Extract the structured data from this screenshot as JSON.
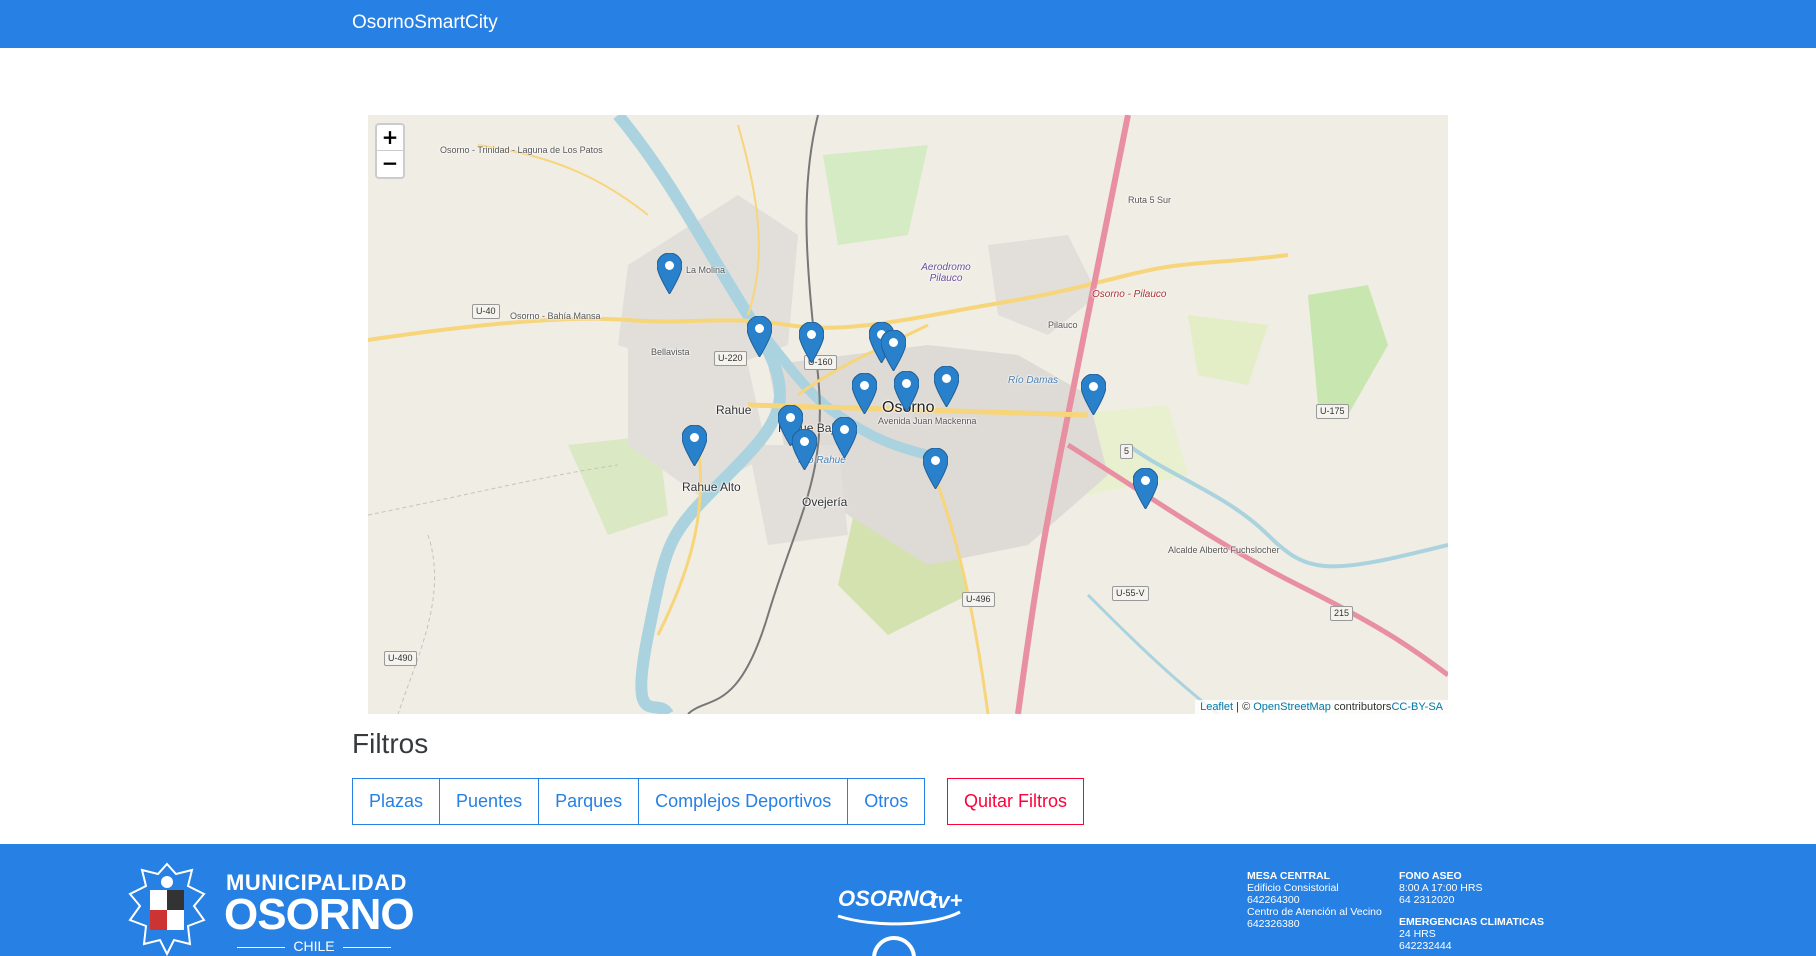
{
  "navbar": {
    "brand": "OsornoSmartCity"
  },
  "map": {
    "zoom_in": "+",
    "zoom_out": "−",
    "labels": {
      "osorno": "Osorno",
      "rahue": "Rahue",
      "rahue_alto": "Rahue Alto",
      "ovejeria": "Ovejería",
      "rahue_bajo": "Rahue Bajo",
      "aerodromo": "Aerodromo Pilauco",
      "osorno_pilauco": "Osorno - Pilauco",
      "rio_rahue": "Río Rahue",
      "rio_damas": "Río Damas",
      "bellavista": "Bellavista",
      "la_molina": "La Molina",
      "osorno_bahia": "Osorno - Bahía Mansa",
      "osorno_trinidad": "Osorno - Trinidad - Laguna de Los Patos",
      "juan_mackenna": "Avenida Juan Mackenna",
      "ruta5sur": "Ruta 5 Sur",
      "alcalde": "Alcalde Alberto Fuchslocher",
      "pilauco": "Pilauco"
    },
    "shields": {
      "u40": "U-40",
      "u220": "U-220",
      "u160": "U-160",
      "u175": "U-175",
      "u490": "U-490",
      "u496": "U-496",
      "u55v": "U-55-V",
      "r215": "215",
      "r5": "5"
    },
    "attribution": {
      "leaflet": "Leaflet",
      "sep": " | © ",
      "osm": "OpenStreetMap",
      "contrib": " contributors",
      "license": "CC-BY-SA"
    }
  },
  "filters": {
    "title": "Filtros",
    "buttons": [
      "Plazas",
      "Puentes",
      "Parques",
      "Complejos Deportivos",
      "Otros"
    ],
    "clear": "Quitar Filtros"
  },
  "footer": {
    "muni_small": "MUNICIPALIDAD",
    "muni_big": "OSORNO",
    "muni_country": "CHILE",
    "tv_logo": "OSORNO tv+",
    "mesa_central": {
      "title": "MESA CENTRAL",
      "lines": [
        "Edificio Consistorial",
        "642264300",
        "Centro de Atención al Vecino",
        "642326380"
      ]
    },
    "fono_aseo": {
      "title": "FONO ASEO",
      "lines": [
        "8:00 A 17:00 HRS",
        "64 2312020"
      ]
    },
    "emergencias": {
      "title": "EMERGENCIAS CLIMATICAS",
      "lines": [
        "24 HRS",
        "642232444"
      ]
    }
  },
  "colors": {
    "primary": "#2780e3",
    "danger": "#ff0039",
    "marker": "#2a81cb"
  }
}
